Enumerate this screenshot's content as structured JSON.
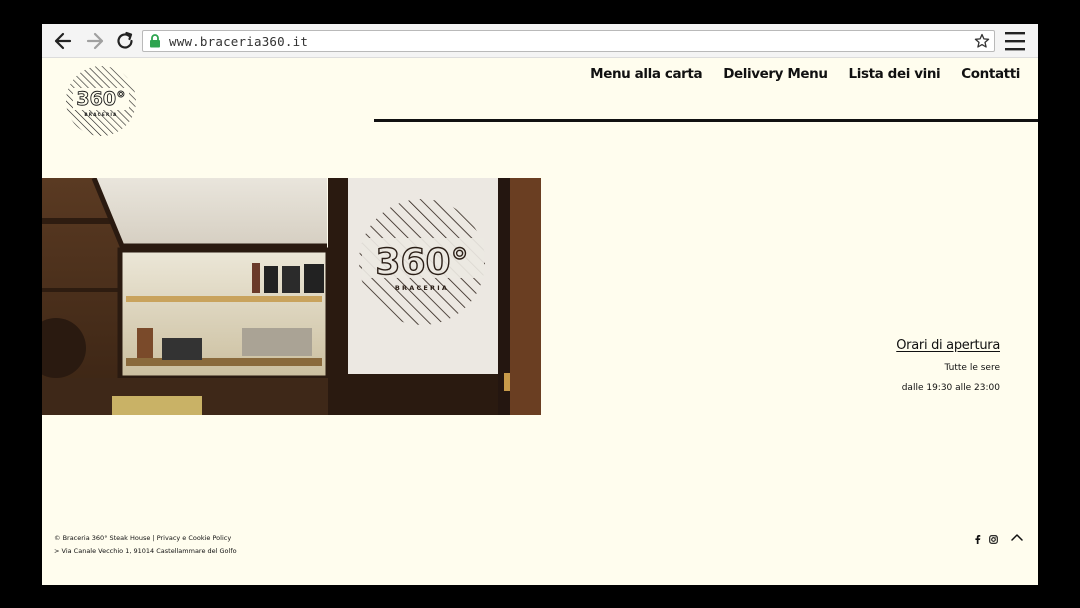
{
  "browser": {
    "url": "www.braceria360.it",
    "icons": {
      "back": "back-arrow-icon",
      "forward": "forward-arrow-icon",
      "reload": "reload-icon",
      "lock": "lock-icon",
      "bookmark": "star-icon",
      "menu": "hamburger-menu-icon"
    }
  },
  "site": {
    "logo": {
      "big_text": "360°",
      "small_text": "BRACERIA"
    },
    "nav": [
      {
        "label": "Menu alla carta"
      },
      {
        "label": "Delivery Menu"
      },
      {
        "label": "Lista dei vini"
      },
      {
        "label": "Contatti"
      }
    ],
    "hero": {
      "sign_text": "360°",
      "sign_subtext": "BRACERIA"
    },
    "hours": {
      "title": "Orari di apertura",
      "line1": "Tutte le sere",
      "line2": "dalle 19:30 alle 23:00"
    },
    "footer": {
      "copyright": "© Braceria 360° Steak House",
      "separator": " | ",
      "privacy_link": "Privacy e Cookie Policy",
      "address": "> Via Canale Vecchio 1, 91014 Castellammare del Golfo",
      "social_icons": [
        "facebook-icon",
        "instagram-icon"
      ],
      "top_icon": "chevron-up-icon"
    }
  },
  "colors": {
    "page_background": "#fffdee",
    "text": "#111111",
    "lock_green": "#2ea44f"
  }
}
